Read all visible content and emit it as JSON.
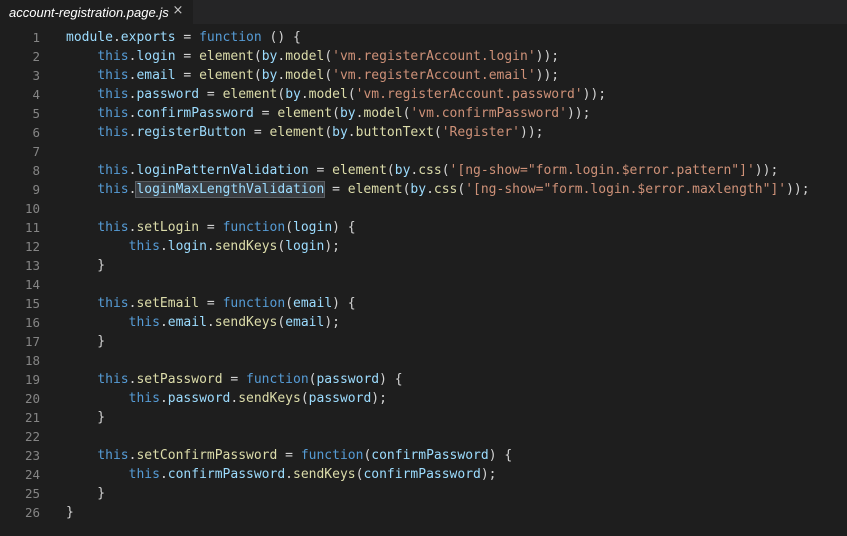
{
  "tab": {
    "title": "account-registration.page.js",
    "close_glyph": "×"
  },
  "colors": {
    "background": "#1e1e1e",
    "keyword": "#569cd6",
    "string": "#ce9178",
    "identifier": "#9cdcfe",
    "function": "#dcdcaa",
    "punctuation": "#d4d4d4",
    "line_number": "#858585"
  },
  "lines": [
    [
      [
        "id",
        "module"
      ],
      [
        "p",
        "."
      ],
      [
        "id",
        "exports"
      ],
      [
        "p",
        " = "
      ],
      [
        "kw",
        "function"
      ],
      [
        "p",
        " () {"
      ]
    ],
    [
      [
        "p",
        "    "
      ],
      [
        "kw",
        "this"
      ],
      [
        "p",
        "."
      ],
      [
        "id",
        "login"
      ],
      [
        "p",
        " = "
      ],
      [
        "fn",
        "element"
      ],
      [
        "p",
        "("
      ],
      [
        "id",
        "by"
      ],
      [
        "p",
        "."
      ],
      [
        "fn",
        "model"
      ],
      [
        "p",
        "("
      ],
      [
        "str",
        "'vm.registerAccount.login'"
      ],
      [
        "p",
        "));"
      ]
    ],
    [
      [
        "p",
        "    "
      ],
      [
        "kw",
        "this"
      ],
      [
        "p",
        "."
      ],
      [
        "id",
        "email"
      ],
      [
        "p",
        " = "
      ],
      [
        "fn",
        "element"
      ],
      [
        "p",
        "("
      ],
      [
        "id",
        "by"
      ],
      [
        "p",
        "."
      ],
      [
        "fn",
        "model"
      ],
      [
        "p",
        "("
      ],
      [
        "str",
        "'vm.registerAccount.email'"
      ],
      [
        "p",
        "));"
      ]
    ],
    [
      [
        "p",
        "    "
      ],
      [
        "kw",
        "this"
      ],
      [
        "p",
        "."
      ],
      [
        "id",
        "password"
      ],
      [
        "p",
        " = "
      ],
      [
        "fn",
        "element"
      ],
      [
        "p",
        "("
      ],
      [
        "id",
        "by"
      ],
      [
        "p",
        "."
      ],
      [
        "fn",
        "model"
      ],
      [
        "p",
        "("
      ],
      [
        "str",
        "'vm.registerAccount.password'"
      ],
      [
        "p",
        "));"
      ]
    ],
    [
      [
        "p",
        "    "
      ],
      [
        "kw",
        "this"
      ],
      [
        "p",
        "."
      ],
      [
        "id",
        "confirmPassword"
      ],
      [
        "p",
        " = "
      ],
      [
        "fn",
        "element"
      ],
      [
        "p",
        "("
      ],
      [
        "id",
        "by"
      ],
      [
        "p",
        "."
      ],
      [
        "fn",
        "model"
      ],
      [
        "p",
        "("
      ],
      [
        "str",
        "'vm.confirmPassword'"
      ],
      [
        "p",
        "));"
      ]
    ],
    [
      [
        "p",
        "    "
      ],
      [
        "kw",
        "this"
      ],
      [
        "p",
        "."
      ],
      [
        "id",
        "registerButton"
      ],
      [
        "p",
        " = "
      ],
      [
        "fn",
        "element"
      ],
      [
        "p",
        "("
      ],
      [
        "id",
        "by"
      ],
      [
        "p",
        "."
      ],
      [
        "fn",
        "buttonText"
      ],
      [
        "p",
        "("
      ],
      [
        "str",
        "'Register'"
      ],
      [
        "p",
        "));"
      ]
    ],
    [],
    [
      [
        "p",
        "    "
      ],
      [
        "kw",
        "this"
      ],
      [
        "p",
        "."
      ],
      [
        "id",
        "loginPatternValidation"
      ],
      [
        "p",
        " = "
      ],
      [
        "fn",
        "element"
      ],
      [
        "p",
        "("
      ],
      [
        "id",
        "by"
      ],
      [
        "p",
        "."
      ],
      [
        "fn",
        "css"
      ],
      [
        "p",
        "("
      ],
      [
        "str",
        "'[ng-show=\"form.login.$error.pattern\"]'"
      ],
      [
        "p",
        "));"
      ]
    ],
    [
      [
        "p",
        "    "
      ],
      [
        "kw",
        "this"
      ],
      [
        "p",
        "."
      ],
      [
        "sel",
        "loginMaxLengthValidation"
      ],
      [
        "p",
        " = "
      ],
      [
        "fn",
        "element"
      ],
      [
        "p",
        "("
      ],
      [
        "id",
        "by"
      ],
      [
        "p",
        "."
      ],
      [
        "fn",
        "css"
      ],
      [
        "p",
        "("
      ],
      [
        "str",
        "'[ng-show=\"form.login.$error.maxlength\"]'"
      ],
      [
        "p",
        "));"
      ]
    ],
    [],
    [
      [
        "p",
        "    "
      ],
      [
        "kw",
        "this"
      ],
      [
        "p",
        "."
      ],
      [
        "fn",
        "setLogin"
      ],
      [
        "p",
        " = "
      ],
      [
        "kw",
        "function"
      ],
      [
        "p",
        "("
      ],
      [
        "id",
        "login"
      ],
      [
        "p",
        ") {"
      ]
    ],
    [
      [
        "p",
        "        "
      ],
      [
        "kw",
        "this"
      ],
      [
        "p",
        "."
      ],
      [
        "id",
        "login"
      ],
      [
        "p",
        "."
      ],
      [
        "fn",
        "sendKeys"
      ],
      [
        "p",
        "("
      ],
      [
        "id",
        "login"
      ],
      [
        "p",
        ");"
      ]
    ],
    [
      [
        "p",
        "    }"
      ]
    ],
    [],
    [
      [
        "p",
        "    "
      ],
      [
        "kw",
        "this"
      ],
      [
        "p",
        "."
      ],
      [
        "fn",
        "setEmail"
      ],
      [
        "p",
        " = "
      ],
      [
        "kw",
        "function"
      ],
      [
        "p",
        "("
      ],
      [
        "id",
        "email"
      ],
      [
        "p",
        ") {"
      ]
    ],
    [
      [
        "p",
        "        "
      ],
      [
        "kw",
        "this"
      ],
      [
        "p",
        "."
      ],
      [
        "id",
        "email"
      ],
      [
        "p",
        "."
      ],
      [
        "fn",
        "sendKeys"
      ],
      [
        "p",
        "("
      ],
      [
        "id",
        "email"
      ],
      [
        "p",
        ");"
      ]
    ],
    [
      [
        "p",
        "    }"
      ]
    ],
    [],
    [
      [
        "p",
        "    "
      ],
      [
        "kw",
        "this"
      ],
      [
        "p",
        "."
      ],
      [
        "fn",
        "setPassword"
      ],
      [
        "p",
        " = "
      ],
      [
        "kw",
        "function"
      ],
      [
        "p",
        "("
      ],
      [
        "id",
        "password"
      ],
      [
        "p",
        ") {"
      ]
    ],
    [
      [
        "p",
        "        "
      ],
      [
        "kw",
        "this"
      ],
      [
        "p",
        "."
      ],
      [
        "id",
        "password"
      ],
      [
        "p",
        "."
      ],
      [
        "fn",
        "sendKeys"
      ],
      [
        "p",
        "("
      ],
      [
        "id",
        "password"
      ],
      [
        "p",
        ");"
      ]
    ],
    [
      [
        "p",
        "    }"
      ]
    ],
    [],
    [
      [
        "p",
        "    "
      ],
      [
        "kw",
        "this"
      ],
      [
        "p",
        "."
      ],
      [
        "fn",
        "setConfirmPassword"
      ],
      [
        "p",
        " = "
      ],
      [
        "kw",
        "function"
      ],
      [
        "p",
        "("
      ],
      [
        "id",
        "confirmPassword"
      ],
      [
        "p",
        ") {"
      ]
    ],
    [
      [
        "p",
        "        "
      ],
      [
        "kw",
        "this"
      ],
      [
        "p",
        "."
      ],
      [
        "id",
        "confirmPassword"
      ],
      [
        "p",
        "."
      ],
      [
        "fn",
        "sendKeys"
      ],
      [
        "p",
        "("
      ],
      [
        "id",
        "confirmPassword"
      ],
      [
        "p",
        ");"
      ]
    ],
    [
      [
        "p",
        "    }"
      ]
    ],
    [
      [
        "p",
        "}"
      ]
    ]
  ]
}
